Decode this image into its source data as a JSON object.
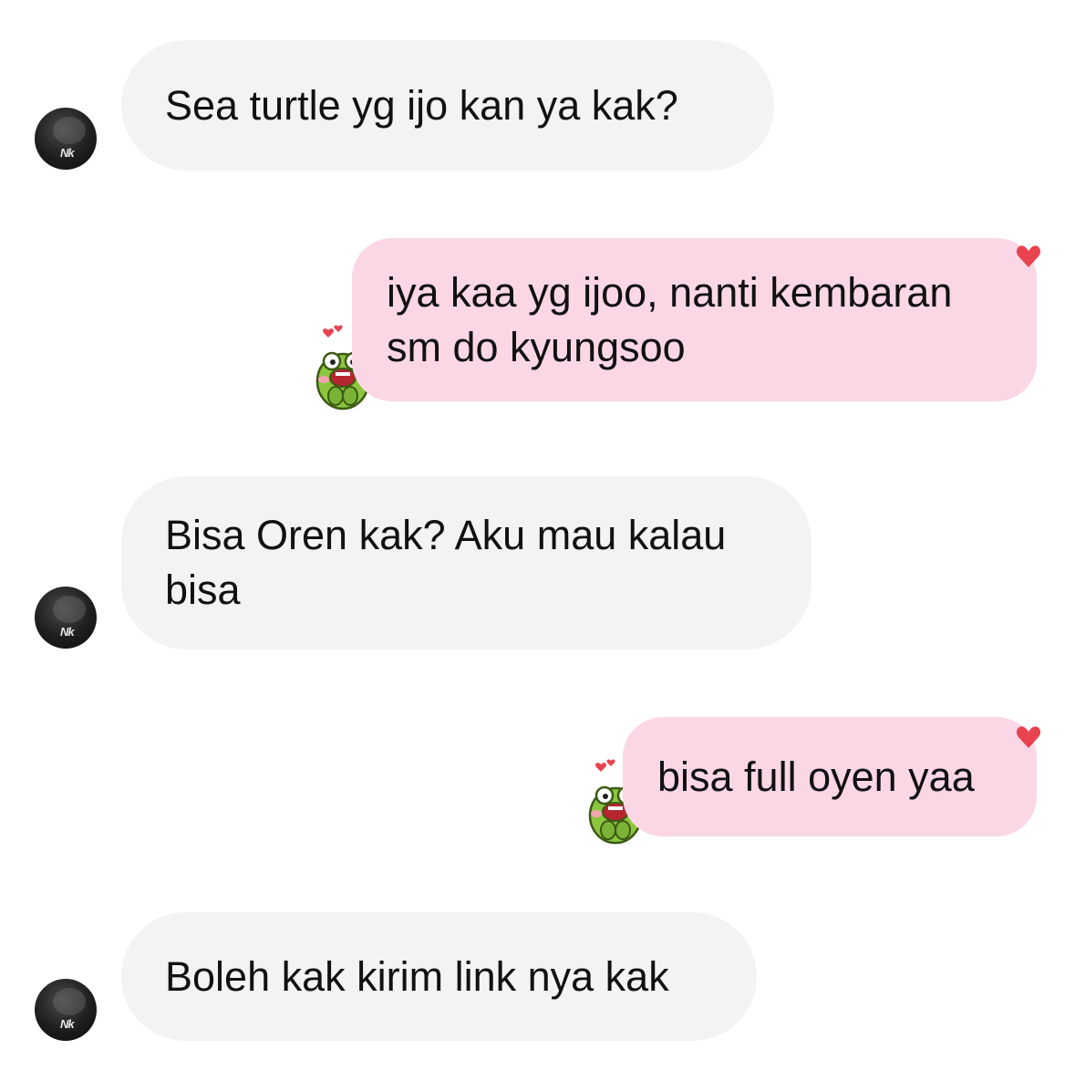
{
  "conversation": {
    "messages": [
      {
        "direction": "incoming",
        "text": "Sea turtle yg ijo kan ya kak?"
      },
      {
        "direction": "outgoing",
        "text": "iya kaa yg ijoo, nanti kembaran\nsm do kyungsoo",
        "reaction": "heart-icon",
        "sticker": "frog-sticker"
      },
      {
        "direction": "incoming",
        "text": "Bisa Oren kak? Aku mau kalau\nbisa"
      },
      {
        "direction": "outgoing",
        "text": "bisa full oyen yaa",
        "reaction": "heart-icon",
        "sticker": "frog-sticker"
      },
      {
        "direction": "incoming",
        "text": "Boleh kak kirim link nya kak"
      }
    ]
  },
  "colors": {
    "incoming_bubble": "#f3f3f3",
    "outgoing_bubble": "#fbd7e6",
    "heart": "#e8434f",
    "text": "#111111"
  }
}
